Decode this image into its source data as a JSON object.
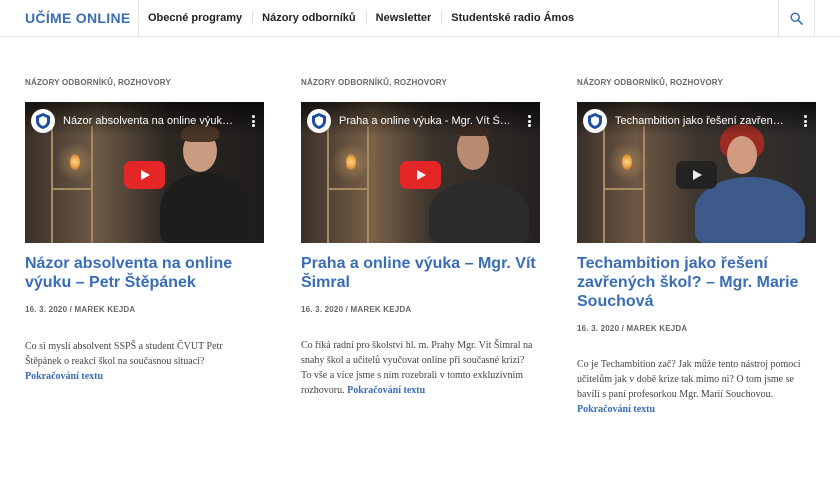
{
  "site": {
    "logo": "UČÍME ONLINE"
  },
  "nav": {
    "items": [
      "Obecné programy",
      "Názory odborníků",
      "Newsletter",
      "Studentské radio Ámos"
    ]
  },
  "posts": [
    {
      "categories": [
        "NÁZORY ODBORNÍKŮ",
        "ROZHOVORY"
      ],
      "video_title": "Názor absolventa na online výuk…",
      "title": "Názor absolventa na online výuku – Petr Štěpánek",
      "meta": "16. 3. 2020 / MAREK KEJDA",
      "excerpt": "Co si myslí absolvent SSPŠ a student ČVUT Petr Štěpánek o reakci škol na současnou situaci?",
      "more": "Pokračování textu"
    },
    {
      "categories": [
        "NÁZORY ODBORNÍKŮ",
        "ROZHOVORY"
      ],
      "video_title": "Praha a online výuka - Mgr. Vít Š…",
      "title": "Praha a online výuka – Mgr. Vít Šimral",
      "meta": "16. 3. 2020 / MAREK KEJDA",
      "excerpt": "Co říká radní pro školství hl. m. Prahy Mgr. Vít Šimral na snahy škol a učitelů vyučovat online při současné krizi? To vše a více jsme s ním rozebrali v tomto exkluzivním rozhovoru.",
      "more": "Pokračování textu"
    },
    {
      "categories": [
        "NÁZORY ODBORNÍKŮ",
        "ROZHOVORY"
      ],
      "video_title": "Techambition jako řešení zavřen…",
      "title": "Techambition jako řešení zavřených škol? – Mgr. Marie Souchová",
      "meta": "16. 3. 2020 / MAREK KEJDA",
      "excerpt": "Co je Techambition zač? Jak může tento nástroj pomoci učitelům jak v době krize tak mimo ni? O tom jsme se bavili s paní profesorkou Mgr. Marií Souchovou.",
      "more": "Pokračování textu"
    }
  ],
  "colors": {
    "accent": "#3a6db5",
    "youtube_red": "#e52626"
  },
  "icons": {
    "search": "search-icon",
    "play": "play-icon",
    "menu": "kebab-menu-icon",
    "channel": "school-crest-icon"
  }
}
